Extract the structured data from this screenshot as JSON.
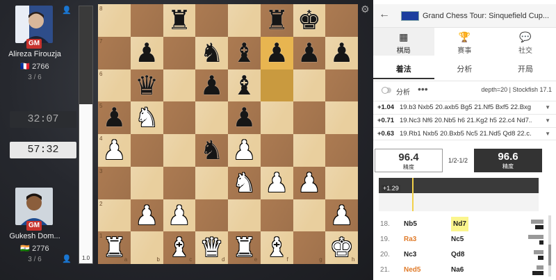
{
  "players": {
    "top": {
      "title": "GM",
      "name": "Alireza Firouzja",
      "flag": "🇫🇷",
      "rating": "2766",
      "score": "3 / 6",
      "clock": "32:07"
    },
    "bottom": {
      "title": "GM",
      "name": "Gukesh Dom...",
      "flag": "🇮🇳",
      "rating": "2776",
      "score": "3 / 6",
      "clock": "57:32"
    }
  },
  "eval_bar": {
    "label": "1.0",
    "white_fraction": 0.62
  },
  "board": {
    "files": [
      "a",
      "b",
      "c",
      "d",
      "e",
      "f",
      "g",
      "h"
    ],
    "ranks": [
      "8",
      "7",
      "6",
      "5",
      "4",
      "3",
      "2",
      "1"
    ],
    "pieces": [
      {
        "sq": "c8",
        "p": "♜",
        "c": "b"
      },
      {
        "sq": "f8",
        "p": "♜",
        "c": "b"
      },
      {
        "sq": "g8",
        "p": "♚",
        "c": "b"
      },
      {
        "sq": "b7",
        "p": "♟",
        "c": "b"
      },
      {
        "sq": "d7",
        "p": "♞",
        "c": "b"
      },
      {
        "sq": "e7",
        "p": "♝",
        "c": "b"
      },
      {
        "sq": "f7",
        "p": "♟",
        "c": "b"
      },
      {
        "sq": "g7",
        "p": "♟",
        "c": "b"
      },
      {
        "sq": "h7",
        "p": "♟",
        "c": "b"
      },
      {
        "sq": "b6",
        "p": "♛",
        "c": "b"
      },
      {
        "sq": "d6",
        "p": "♟",
        "c": "b"
      },
      {
        "sq": "e6",
        "p": "♝",
        "c": "b"
      },
      {
        "sq": "a5",
        "p": "♟",
        "c": "b"
      },
      {
        "sq": "b5",
        "p": "♞",
        "c": "w"
      },
      {
        "sq": "e5",
        "p": "♟",
        "c": "b"
      },
      {
        "sq": "a4",
        "p": "♟",
        "c": "w"
      },
      {
        "sq": "d4",
        "p": "♞",
        "c": "b"
      },
      {
        "sq": "e4",
        "p": "♟",
        "c": "w"
      },
      {
        "sq": "e3",
        "p": "♞",
        "c": "w"
      },
      {
        "sq": "f3",
        "p": "♟",
        "c": "w"
      },
      {
        "sq": "g3",
        "p": "♟",
        "c": "w"
      },
      {
        "sq": "b2",
        "p": "♟",
        "c": "w"
      },
      {
        "sq": "c2",
        "p": "♟",
        "c": "w"
      },
      {
        "sq": "h2",
        "p": "♟",
        "c": "w"
      },
      {
        "sq": "a1",
        "p": "♜",
        "c": "w"
      },
      {
        "sq": "c1",
        "p": "♝",
        "c": "w"
      },
      {
        "sq": "d1",
        "p": "♛",
        "c": "w"
      },
      {
        "sq": "e1",
        "p": "♜",
        "c": "w"
      },
      {
        "sq": "f1",
        "p": "♝",
        "c": "w"
      },
      {
        "sq": "h1",
        "p": "♚",
        "c": "w"
      }
    ],
    "highlights": [
      "f6",
      "f7"
    ]
  },
  "panel": {
    "event_title": "Grand Chess Tour: Sinquefield Cup...",
    "nav_tabs": [
      {
        "icon": "board-icon",
        "glyph": "▦",
        "label": "棋局"
      },
      {
        "icon": "trophy-icon",
        "glyph": "🏆",
        "label": "赛事"
      },
      {
        "icon": "chat-icon",
        "glyph": "💬",
        "label": "社交"
      }
    ],
    "sub_tabs": [
      "着法",
      "分析",
      "开局"
    ],
    "analysis_label": "分析",
    "engine_info": "depth=20 | Stockfish 17.1",
    "lines": [
      {
        "score": "+1.04",
        "moves": "19.b3 Nxb5 20.axb5 Bg5 21.Nf5 Bxf5 22.Bxg..."
      },
      {
        "score": "+0.71",
        "moves": "19.Nc3 Nf6 20.Nb5 h6 21.Kg2 h5 22.c4 Nd7..."
      },
      {
        "score": "+0.63",
        "moves": "19.Rb1 Nxb5 20.Bxb5 Nc5 21.Nd5 Qd8 22.c..."
      }
    ],
    "accuracy": {
      "white": "96.4",
      "black": "96.6",
      "label": "精度",
      "result": "1/2-1/2"
    },
    "graph_label": "+1.29",
    "moves": [
      {
        "no": "18.",
        "w": "Nb5",
        "b": "Nd7",
        "w_color": "#222",
        "b_hl": true,
        "bar1": 18,
        "bar2": 12
      },
      {
        "no": "19.",
        "w": "Ra3",
        "b": "Nc5",
        "w_color": "#e07b2a",
        "b_hl": false,
        "bar1": 22,
        "bar2": 6
      },
      {
        "no": "20.",
        "w": "Nc3",
        "b": "Qd8",
        "w_color": "#222",
        "b_hl": false,
        "bar1": 14,
        "bar2": 8
      },
      {
        "no": "21.",
        "w": "Ned5",
        "b": "Na6",
        "w_color": "#e07b2a",
        "b_hl": false,
        "bar1": 10,
        "bar2": 16
      }
    ]
  }
}
